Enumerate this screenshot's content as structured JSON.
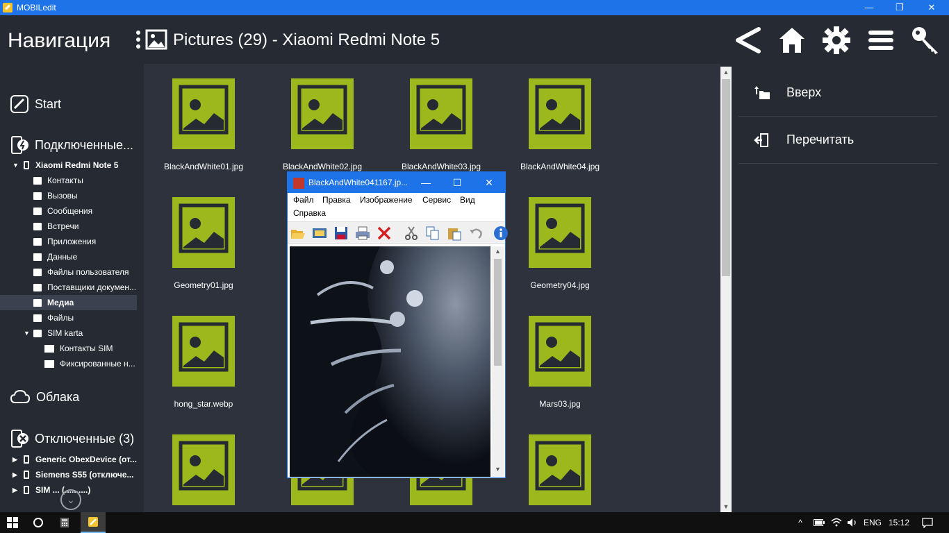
{
  "window": {
    "title": "MOBILedit",
    "minimize": "—",
    "maximize": "❐",
    "close": "✕"
  },
  "header": {
    "nav_title": "Навигация",
    "path_title": "Pictures (29) - Xiaomi Redmi Note 5",
    "icons": [
      "back-icon",
      "home-icon",
      "gear-icon",
      "menu-icon",
      "key-icon"
    ]
  },
  "nav": {
    "start": "Start",
    "connected": "Подключенные...",
    "device": "Xiaomi Redmi Note 5",
    "items": [
      {
        "label": "Контакты",
        "icon": "contacts-icon"
      },
      {
        "label": "Вызовы",
        "icon": "calls-icon"
      },
      {
        "label": "Сообщения",
        "icon": "messages-icon"
      },
      {
        "label": "Встречи",
        "icon": "calendar-icon"
      },
      {
        "label": "Приложения",
        "icon": "apps-icon"
      },
      {
        "label": "Данные",
        "icon": "folder-icon"
      },
      {
        "label": "Файлы пользователя",
        "icon": "folder-icon"
      },
      {
        "label": "Поставщики докумен...",
        "icon": "folder-icon"
      },
      {
        "label": "Медиа",
        "icon": "media-icon",
        "selected": true
      },
      {
        "label": "Файлы",
        "icon": "folder-icon"
      },
      {
        "label": "SIM karta",
        "icon": "folder-icon"
      }
    ],
    "sim_items": [
      {
        "label": "Контакты SIM",
        "icon": "sim-contacts-icon"
      },
      {
        "label": "Фиксированные н...",
        "icon": "sim-fixed-icon"
      }
    ],
    "cloud": "Облака",
    "disconnected": "Отключенные (3)",
    "disconnected_items": [
      {
        "label": "Generic ObexDevice (от..."
      },
      {
        "label": "Siemens S55 (отключе..."
      },
      {
        "label": "SIM ... (..........)"
      }
    ]
  },
  "grid": {
    "files": [
      {
        "name": "BlackAndWhite01.jpg"
      },
      {
        "name": "BlackAndWhite02.jpg"
      },
      {
        "name": "BlackAndWhite03.jpg"
      },
      {
        "name": "BlackAndWhite04.jpg"
      },
      {
        "name": "Geometry01.jpg"
      },
      {
        "name": ""
      },
      {
        "name": ""
      },
      {
        "name": "Geometry04.jpg"
      },
      {
        "name": "hong_star.webp"
      },
      {
        "name": ""
      },
      {
        "name": ""
      },
      {
        "name": "Mars03.jpg"
      },
      {
        "name": ""
      },
      {
        "name": ""
      },
      {
        "name": ""
      },
      {
        "name": ""
      }
    ],
    "thumb_color": "#9cb81d"
  },
  "right": {
    "up": "Вверх",
    "reread": "Перечитать"
  },
  "viewer": {
    "title": "BlackAndWhite041167.jp...",
    "minimize": "—",
    "maximize": "☐",
    "close": "✕",
    "menu": [
      "Файл",
      "Правка",
      "Изображение",
      "Сервис",
      "Вид",
      "Справка"
    ],
    "tools": [
      "open-icon",
      "slideshow-icon",
      "save-icon",
      "print-icon",
      "delete-icon",
      "cut-icon",
      "copy-icon",
      "paste-icon",
      "undo-icon",
      "info-icon"
    ]
  },
  "taskbar": {
    "lang": "ENG",
    "time": "15:12"
  }
}
